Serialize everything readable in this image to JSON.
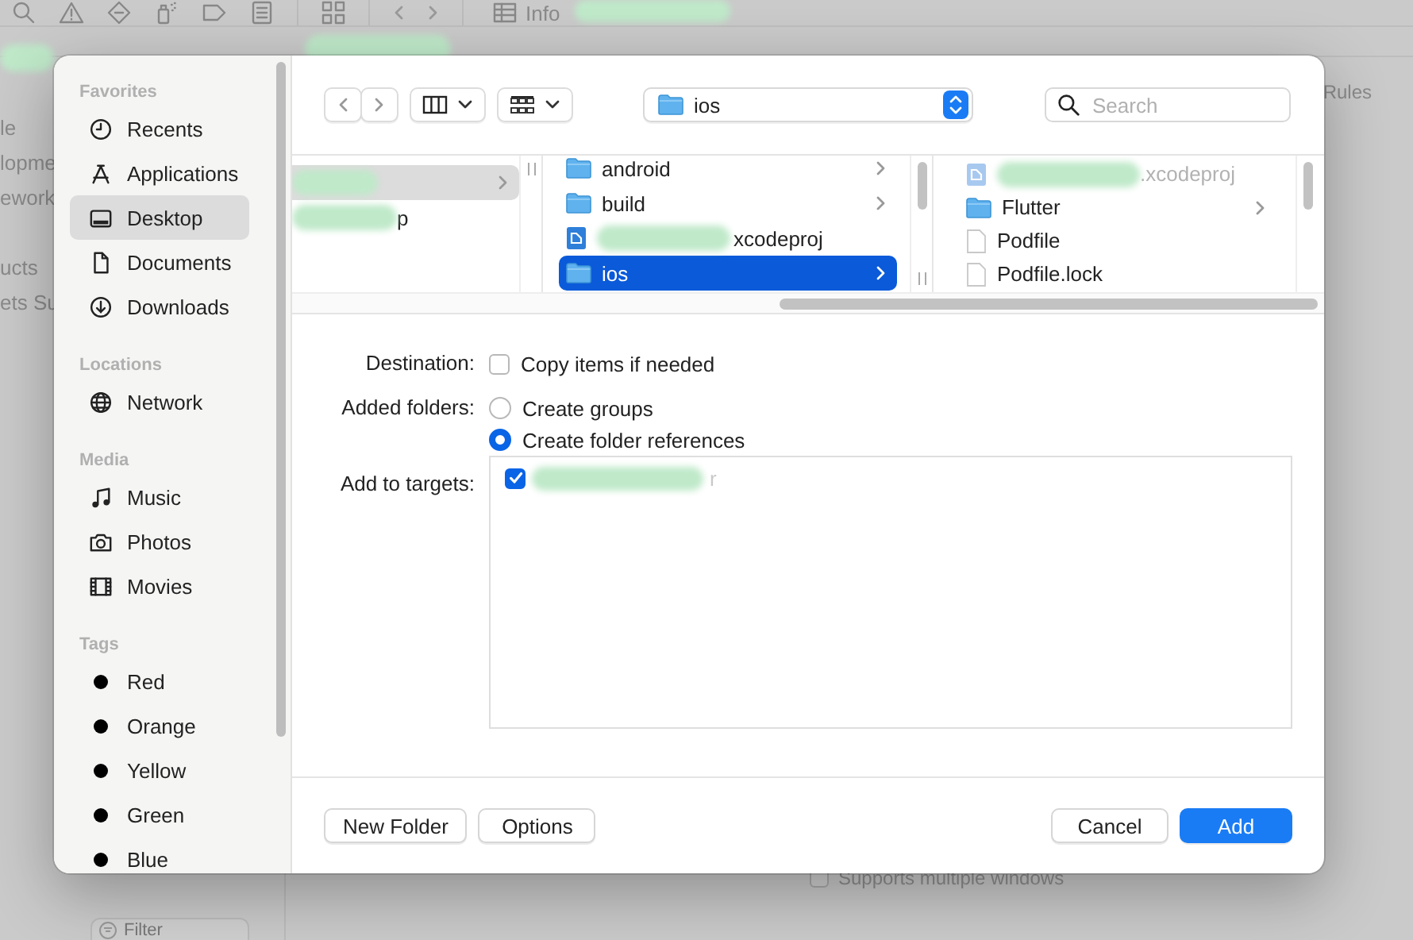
{
  "background": {
    "info_tab": "Info",
    "navigator_groups": [
      [
        "le",
        "lopme",
        "ework"
      ],
      [
        "ucts",
        "ets Su"
      ]
    ],
    "inspector_tab": "Rules",
    "option": {
      "label": "Supports multiple windows",
      "checked": false
    },
    "filter_placeholder": "Filter",
    "redaction_marks": [
      {
        "kind": "toolbar"
      },
      {
        "kind": "tab"
      },
      {
        "kind": "navigator"
      }
    ]
  },
  "dialog": {
    "sidebar": [
      {
        "title": "Favorites",
        "items": [
          {
            "label": "Recents",
            "kind": "clock",
            "selected": false
          },
          {
            "label": "Applications",
            "kind": "apps",
            "selected": false
          },
          {
            "label": "Desktop",
            "kind": "desktop",
            "selected": true
          },
          {
            "label": "Documents",
            "kind": "document",
            "selected": false
          },
          {
            "label": "Downloads",
            "kind": "download",
            "selected": false
          }
        ]
      },
      {
        "title": "Locations",
        "items": [
          {
            "label": "Network",
            "kind": "network",
            "selected": false
          }
        ]
      },
      {
        "title": "Media",
        "items": [
          {
            "label": "Music",
            "kind": "music",
            "selected": false
          },
          {
            "label": "Photos",
            "kind": "photos",
            "selected": false
          },
          {
            "label": "Movies",
            "kind": "movies",
            "selected": false
          }
        ]
      },
      {
        "title": "Tags",
        "items": [
          {
            "label": "Red",
            "kind": "tag",
            "selected": false
          },
          {
            "label": "Orange",
            "kind": "tag",
            "selected": false
          },
          {
            "label": "Yellow",
            "kind": "tag",
            "selected": false
          },
          {
            "label": "Green",
            "kind": "tag",
            "selected": false
          },
          {
            "label": "Blue",
            "kind": "tag",
            "selected": false
          }
        ]
      }
    ],
    "toolbar": {
      "path": "ios",
      "search_placeholder": "Search"
    },
    "columns": [
      {
        "rows": [
          {
            "kind": "none",
            "redacted": true,
            "selected": true,
            "expandable": true,
            "disabled": false
          },
          {
            "kind": "none",
            "label": "p",
            "redacted": true,
            "selected": false,
            "expandable": false,
            "disabled": false
          }
        ]
      },
      {
        "rows": [
          {
            "kind": "folder",
            "label": "android",
            "redacted": false,
            "selected": false,
            "expandable": true,
            "disabled": false
          },
          {
            "kind": "folder",
            "label": "build",
            "redacted": false,
            "selected": false,
            "expandable": true,
            "disabled": false
          },
          {
            "kind": "project",
            "label": "xcodeproj",
            "redacted": true,
            "selected": false,
            "expandable": false,
            "disabled": false
          },
          {
            "kind": "folder",
            "label": "ios",
            "redacted": false,
            "selected": true,
            "expandable": true,
            "disabled": false
          }
        ]
      },
      {
        "rows": [
          {
            "kind": "project",
            "label": ".xcodeproj",
            "redacted": true,
            "selected": false,
            "expandable": false,
            "disabled": true
          },
          {
            "kind": "folder",
            "label": "Flutter",
            "redacted": false,
            "selected": false,
            "expandable": true,
            "disabled": false
          },
          {
            "kind": "file",
            "label": "Podfile",
            "redacted": false,
            "selected": false,
            "expandable": false,
            "disabled": false
          },
          {
            "kind": "file",
            "label": "Podfile.lock",
            "redacted": false,
            "selected": false,
            "expandable": false,
            "disabled": false
          }
        ]
      }
    ],
    "options": {
      "destination": {
        "label": "Destination:",
        "checkbox": {
          "label": "Copy items if needed",
          "checked": false
        }
      },
      "added_folders": {
        "label": "Added folders:",
        "choices": [
          {
            "label": "Create groups",
            "selected": false
          },
          {
            "label": "Create folder references",
            "selected": true
          }
        ]
      },
      "targets": {
        "label": "Add to targets:",
        "items": [
          {
            "label": "r",
            "redacted": true,
            "checked": true
          }
        ]
      }
    },
    "buttons_left": [
      {
        "label": "New Folder",
        "kind": "default"
      },
      {
        "label": "Options",
        "kind": "default"
      }
    ],
    "buttons_right": [
      {
        "label": "Cancel",
        "kind": "default"
      },
      {
        "label": "Add",
        "kind": "primary"
      }
    ]
  }
}
